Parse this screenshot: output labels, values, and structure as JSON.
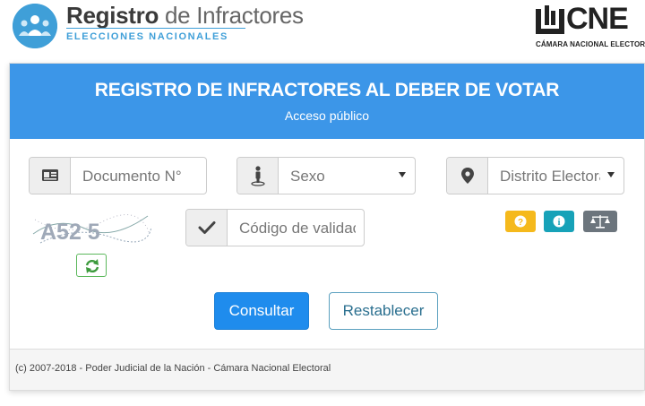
{
  "header": {
    "brand_bold": "Registro",
    "brand_light": " de Infractores",
    "brand_sub": "ELECCIONES NACIONALES",
    "cne_text": "CNE",
    "cne_caption": "CÁMARA NACIONAL ELECTORAL"
  },
  "panel": {
    "title": "REGISTRO DE INFRACTORES AL DEBER DE VOTAR",
    "subtitle": "Acceso público"
  },
  "form": {
    "documento_placeholder": "Documento N°",
    "sexo_value": "Sexo",
    "distrito_value": "Distrito Electoral",
    "codigo_placeholder": "Código de validación",
    "captcha_text": "A52 5"
  },
  "buttons": {
    "consultar": "Consultar",
    "restablecer": "Restablecer"
  },
  "footer": {
    "text": "(c) 2007-2018 - Poder Judicial de la Nación - Cámara Nacional Electoral"
  },
  "colors": {
    "header_blue": "#3c96e8",
    "primary_button": "#1f8ced",
    "help_yellow": "#f5b91c",
    "info_teal": "#17a2b8",
    "legal_gray": "#6c757d"
  },
  "icons": {
    "documento": "id-card-icon",
    "sexo": "person-icon",
    "distrito": "map-marker-icon",
    "codigo": "check-icon",
    "refresh": "refresh-icon",
    "help": "question-icon",
    "info": "info-icon",
    "legal": "balance-scale-icon"
  }
}
